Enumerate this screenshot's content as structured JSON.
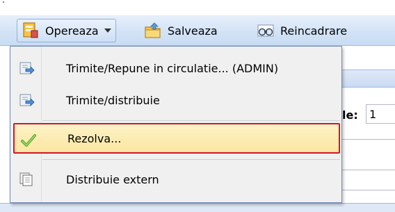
{
  "toolbar": {
    "buttons": [
      {
        "label": "Opereaza",
        "icon": "operate-icon",
        "dropdown": true,
        "active": true
      },
      {
        "label": "Salveaza",
        "icon": "save-folder-icon"
      },
      {
        "label": "Reincadrare",
        "icon": "binoculars-icon"
      }
    ]
  },
  "menu": {
    "items": [
      {
        "label": "Trimite/Repune in circulatie... (ADMIN)",
        "icon": "send-arrow-icon"
      },
      {
        "label": "Trimite/distribuie",
        "icon": "send-arrow-icon"
      },
      {
        "label": "Rezolva...",
        "icon": "checkmark-icon",
        "highlighted": true,
        "highlight_border": "#d5132b"
      },
      {
        "label": "Distribuie extern",
        "icon": "distribute-external-icon"
      }
    ]
  },
  "background": {
    "field_label": "le:",
    "field_value": "1"
  }
}
